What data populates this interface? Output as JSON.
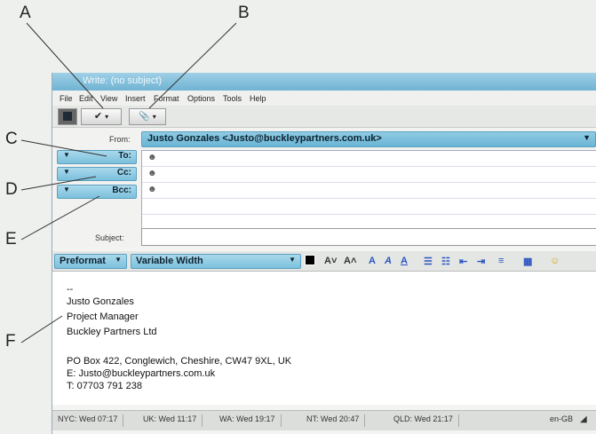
{
  "callouts": [
    "A",
    "B",
    "C",
    "D",
    "E",
    "F"
  ],
  "window": {
    "title": "Write: (no subject)",
    "menu": [
      "File",
      "Edit",
      "View",
      "Insert",
      "Format",
      "Options",
      "Tools",
      "Help"
    ]
  },
  "toolbar": {
    "spell_icon": "✔",
    "attach_icon": "📎",
    "dropdown_icon": "▾"
  },
  "header": {
    "from_label": "From:",
    "from_value": "Justo Gonzales <Justo@buckleypartners.com.uk>",
    "to_label": "To:",
    "cc_label": "Cc:",
    "bcc_label": "Bcc:",
    "subject_label": "Subject:",
    "subject_value": ""
  },
  "format": {
    "paragraph": "Preformat",
    "font": "Variable Width"
  },
  "signature": {
    "dashes": "--",
    "name": "Justo Gonzales",
    "title": "Project Manager",
    "company": "Buckley Partners Ltd",
    "address": "PO Box 422, Conglewich, Cheshire, CW47 9XL, UK",
    "email": "E:   Justo@buckleypartners.com.uk",
    "phone": "T:   07703 791 238"
  },
  "status": {
    "clocks": [
      "NYC: Wed 07:17",
      "UK: Wed 11:17",
      "WA: Wed 19:17",
      "NT: Wed 20:47",
      "QLD: Wed 21:17"
    ],
    "language": "en-GB"
  },
  "colors": {
    "accent": "#7cc0dc",
    "title_bar": "#6fb3d3"
  }
}
